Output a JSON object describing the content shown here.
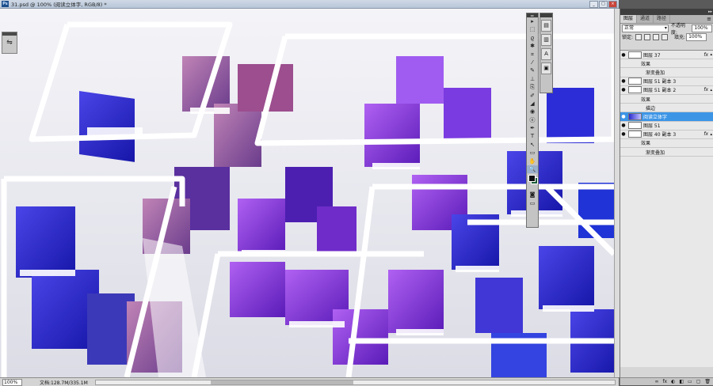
{
  "window": {
    "app_badge": "Ps",
    "doc_title": "31.psd @ 100% (阅读立体字, RGB/8) *"
  },
  "toolbox": {
    "tools": [
      "▸",
      "⬚",
      "ϱ",
      "✱",
      "⌗",
      "⁄",
      "✎",
      "⊥",
      "⎘",
      "✐",
      "◢",
      "◉",
      "ⓔ",
      "✒",
      "T",
      "↖",
      "▭",
      "✋",
      "🔍"
    ],
    "active_tool_index": 18
  },
  "dock": {
    "buttons": [
      "▤",
      "▥",
      "A",
      "▣"
    ]
  },
  "status": {
    "zoom": "100%",
    "doc_info": "文档:128.7M/335.1M"
  },
  "layers_panel": {
    "tabs": [
      "图层",
      "通道",
      "路径"
    ],
    "blend_mode": "正常",
    "opacity_label": "不透明度:",
    "opacity_value": "100%",
    "lock_label": "锁定:",
    "fill_label": "填充:",
    "fill_value": "100%",
    "layers": [
      {
        "name": "图层 37",
        "kind": "layer",
        "fx": true,
        "eye": true
      },
      {
        "name": "效果",
        "kind": "effects"
      },
      {
        "name": "渐变叠加",
        "kind": "effect"
      },
      {
        "name": "图层 51 副本 3",
        "kind": "layer",
        "fx": false,
        "eye": true
      },
      {
        "name": "图层 51 副本 2",
        "kind": "layer",
        "fx": true,
        "eye": true
      },
      {
        "name": "效果",
        "kind": "effects"
      },
      {
        "name": "描边",
        "kind": "effect"
      },
      {
        "name": "阅读立体字",
        "kind": "layer",
        "selected": true,
        "eye": true,
        "image": true
      },
      {
        "name": "图层 51",
        "kind": "layer",
        "eye": true
      },
      {
        "name": "图层 40 副本 3",
        "kind": "layer",
        "fx": true,
        "eye": true
      },
      {
        "name": "效果",
        "kind": "effects"
      },
      {
        "name": "渐变叠加",
        "kind": "effect"
      }
    ],
    "footer_icons": [
      "∞",
      "fx",
      "◐",
      "◧",
      "▭",
      "▢",
      "🗑"
    ]
  },
  "colors": {
    "selection": "#3d95e6",
    "book_blue": "#2323c8",
    "book_purple": "#8a3ad6",
    "book_mauve": "#a35a92"
  }
}
